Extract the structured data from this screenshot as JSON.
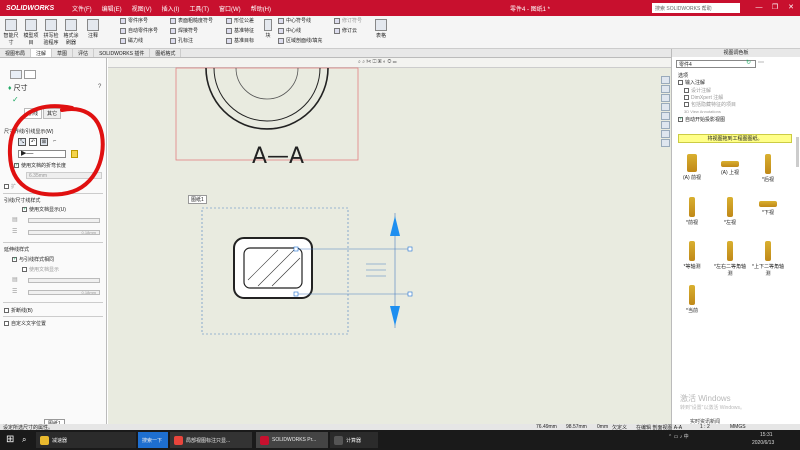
{
  "app": {
    "logo": "SOLIDWORKS",
    "menus": [
      "文件(F)",
      "编辑(E)",
      "视图(V)",
      "插入(I)",
      "工具(T)",
      "窗口(W)",
      "帮助(H)"
    ],
    "doc_title": "零件4 - 图纸1 *",
    "search_placeholder": "搜索 SOLIDWORKS 帮助"
  },
  "commands": {
    "big": [
      "智能尺寸",
      "模型项目",
      "拼写检验程序",
      "格式涂刷器",
      "注释"
    ],
    "small_col1": [
      "零件序号",
      "自动零件序号",
      "磁力线"
    ],
    "small_col2": [
      "表面粗糙度符号",
      "焊接符号",
      "孔标注"
    ],
    "small_col3": [
      "形位公差",
      "基准特征",
      "基准目标"
    ],
    "small_col4": [
      "中心符号线",
      "中心线",
      "区域剖面线/填充"
    ],
    "small_col5": [
      "修订符号",
      "修订云"
    ],
    "block_label": "块",
    "table_label": "表格"
  },
  "tabs": [
    "视图布局",
    "注解",
    "草图",
    "评估",
    "SOLIDWORKS 插件",
    "图纸格式"
  ],
  "active_tab": 1,
  "left_panel": {
    "title": "尺寸",
    "subtabs": [
      "引线",
      "其它"
    ],
    "section1_title": "尺寸界线/引线显示(W)",
    "use_doc_bend": "使用文档的折弯长度",
    "bend_value": "6.35mm",
    "extend_label": "扩",
    "section2_title": "引线/尺寸线样式",
    "use_doc_display": "使用文档显示(U)",
    "line_value1": "0.18mm",
    "section3_title": "延伸线样式",
    "same_as_leader": "与引线样式相同",
    "use_doc_display2": "使用文档显示",
    "line_value2": "0.18mm",
    "break_line": "折断线(B)",
    "custom_text": "自定义文字位置"
  },
  "canvas": {
    "section_label": "A—A",
    "view_label": "图纸1",
    "bottom_tab": "图纸1"
  },
  "right_panel": {
    "title": "视图调色板",
    "part_select": "零件4",
    "options_label": "选项",
    "import_annotations": "输入注解",
    "design_annotations": "设计注解",
    "dimxpert": "DimXpert 注解",
    "hidden_features": "包括隐藏特征的项目",
    "three_d_view": "3D View Annotations",
    "auto_projection": "自动开始投影视图",
    "drag_hint": "将视图拖到工程图图纸。",
    "views": [
      "(A) 前视",
      "(A) 上视",
      "*后视",
      "*前视",
      "*左视",
      "*下视",
      "*等轴测",
      "*左右二等角轴测",
      "*上下二等角轴测",
      "*当前"
    ]
  },
  "status": {
    "left": "设定所选尺寸的属性。",
    "x": "76.49mm",
    "y": "98.57mm",
    "z": "0mm",
    "state": "欠定义",
    "editing": "在编辑 剖面视图 A-A",
    "scale": "1 : 2",
    "units": "MMGS"
  },
  "watermark": {
    "line1": "激活 Windows",
    "line2": "转到“设置”以激活 Windows。"
  },
  "taskbar": {
    "search": "减速器",
    "browser": "搜索一下",
    "chrome": "局部视图标注只显...",
    "solidworks": "SOLIDWORKS Pr...",
    "calc": "计算器",
    "tray_text": "实时资讯新闻",
    "time": "15:31",
    "date": "2020/6/13"
  },
  "colors": {
    "titlebar": "#c8102e",
    "canvas": "#e9ebe0",
    "arrow_blue": "#1e8ff0",
    "red_circle": "#e01010",
    "section_border": "#e08080"
  }
}
